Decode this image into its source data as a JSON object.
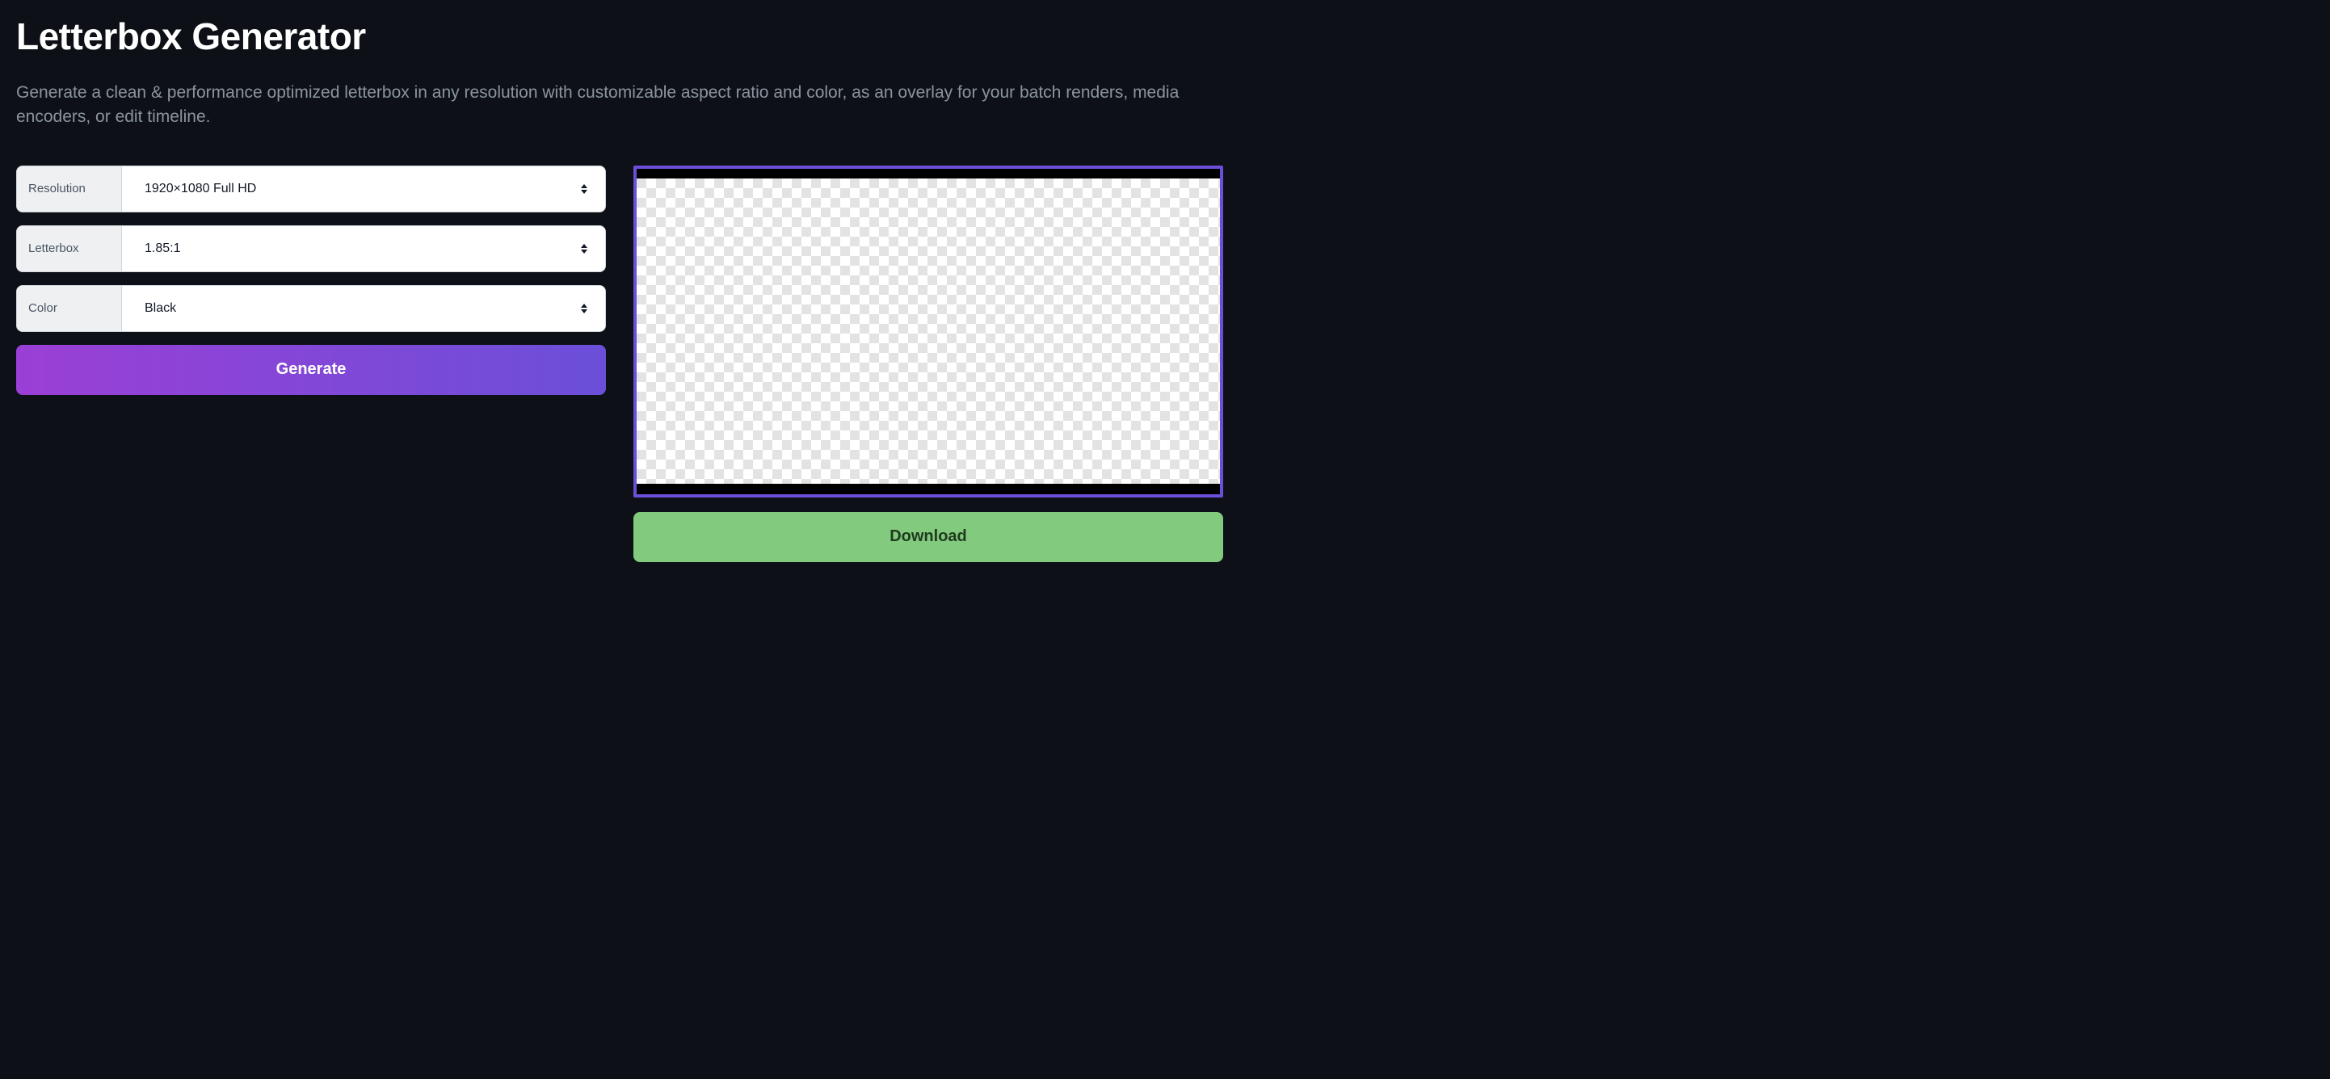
{
  "header": {
    "title": "Letterbox Generator",
    "subtitle": "Generate a clean & performance optimized letterbox in any resolution with customizable aspect ratio and color, as an overlay for your batch renders, media encoders, or edit timeline."
  },
  "form": {
    "resolution": {
      "label": "Resolution",
      "value": "1920×1080 Full HD"
    },
    "letterbox": {
      "label": "Letterbox",
      "value": "1.85:1"
    },
    "color": {
      "label": "Color",
      "value": "Black"
    },
    "generate_label": "Generate"
  },
  "preview": {
    "download_label": "Download",
    "bar_color": "#000000",
    "accent_color": "#6b4fd8"
  }
}
